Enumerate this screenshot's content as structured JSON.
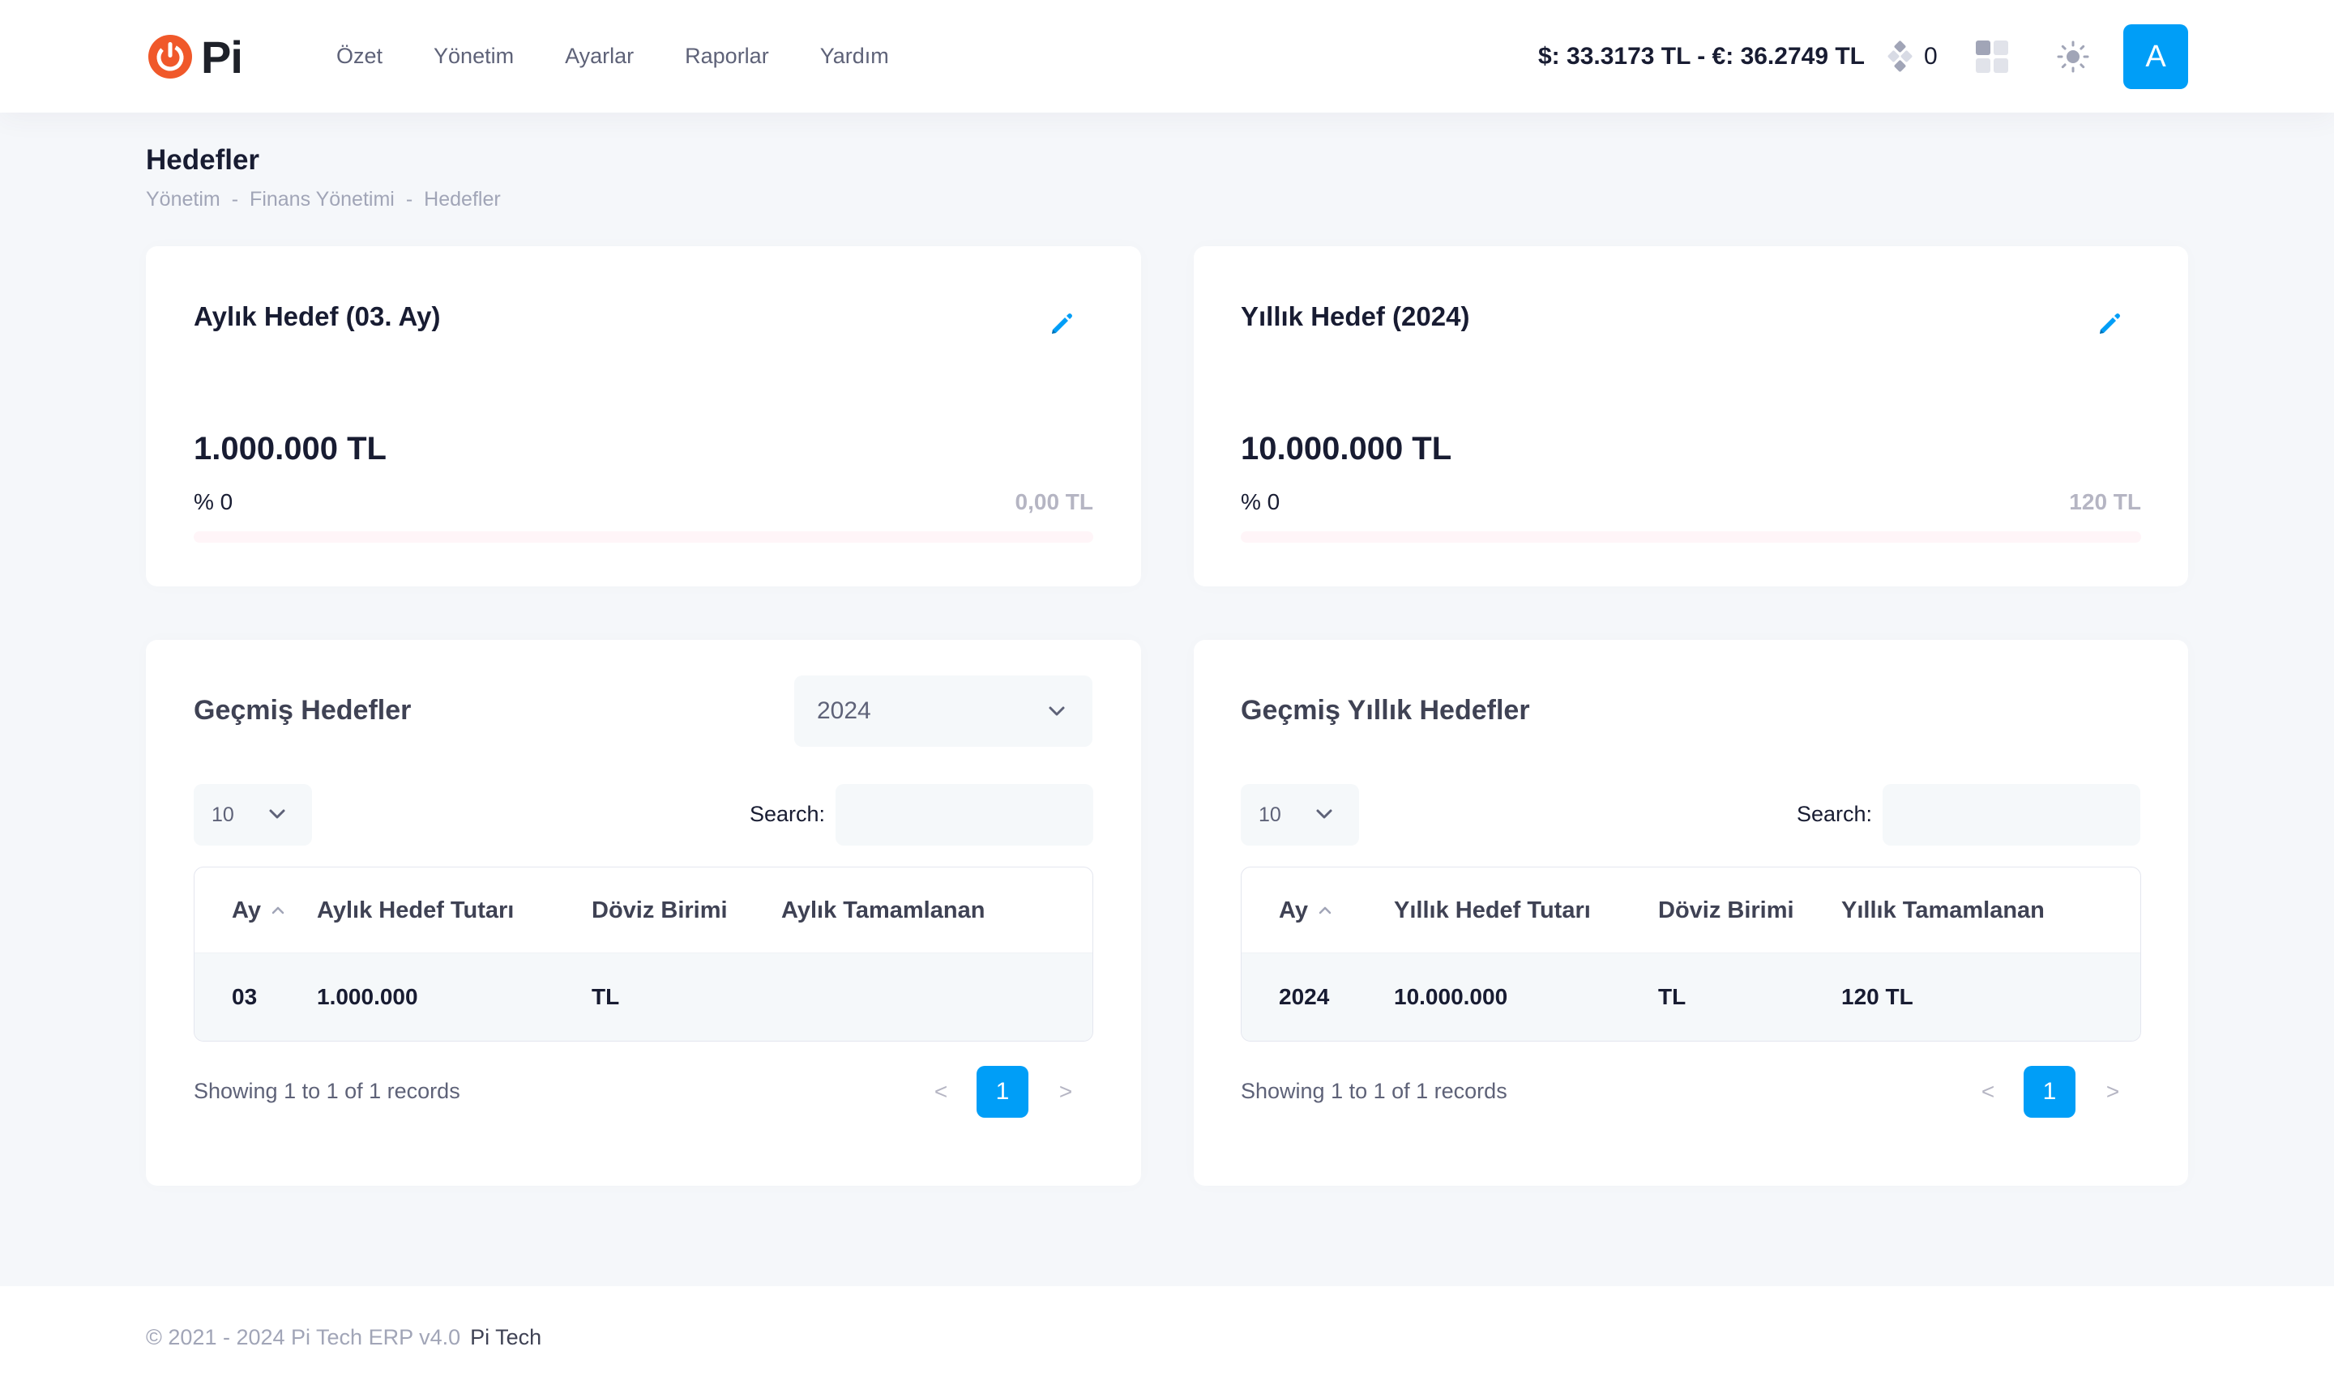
{
  "header": {
    "logo_text": "Pi",
    "nav": [
      "Özet",
      "Yönetim",
      "Ayarlar",
      "Raporlar",
      "Yardım"
    ],
    "rates": "$: 33.3173 TL - €: 36.2749 TL",
    "notifications_count": "0",
    "avatar_letter": "A"
  },
  "page": {
    "title": "Hedefler",
    "breadcrumb": [
      "Yönetim",
      "Finans Yönetimi",
      "Hedefler"
    ],
    "breadcrumb_sep": "-"
  },
  "monthly": {
    "title": "Aylık Hedef (03. Ay)",
    "amount": "1.000.000 TL",
    "percent": "% 0",
    "completed": "0,00 TL",
    "progress": 0
  },
  "yearly": {
    "title": "Yıllık Hedef (2024)",
    "amount": "10.000.000 TL",
    "percent": "% 0",
    "completed": "120 TL",
    "progress": 0
  },
  "past_monthly": {
    "title": "Geçmiş Hedefler",
    "year_select": "2024",
    "page_length": "10",
    "search_label": "Search:",
    "columns": [
      "Ay",
      "Aylık Hedef Tutarı",
      "Döviz Birimi",
      "Aylık Tamamlanan"
    ],
    "rows": [
      [
        "03",
        "1.000.000",
        "TL",
        ""
      ]
    ],
    "info": "Showing 1 to 1 of 1 records",
    "pagination": {
      "prev": "<",
      "current": "1",
      "next": ">"
    }
  },
  "past_yearly": {
    "title": "Geçmiş Yıllık Hedefler",
    "page_length": "10",
    "search_label": "Search:",
    "columns": [
      "Ay",
      "Yıllık Hedef Tutarı",
      "Döviz Birimi",
      "Yıllık Tamamlanan"
    ],
    "rows": [
      [
        "2024",
        "10.000.000",
        "TL",
        "120 TL"
      ]
    ],
    "info": "Showing 1 to 1 of 1 records",
    "pagination": {
      "prev": "<",
      "current": "1",
      "next": ">"
    }
  },
  "footer": {
    "copyright": "© 2021 - 2024 Pi Tech ERP v4.0",
    "link": "Pi Tech"
  },
  "colors": {
    "primary": "#009ef7",
    "brand_orange": "#f0582a",
    "danger": "#f1416c",
    "danger_light": "#fff5f8",
    "background": "#f5f7fa"
  },
  "icons": {
    "logo": "power-icon",
    "notifications": "diamond-cluster-icon",
    "apps": "grid-icon",
    "theme": "sun-icon",
    "edit": "pencil-icon",
    "select": "chevron-down-icon",
    "sort": "chevron-up-icon"
  }
}
